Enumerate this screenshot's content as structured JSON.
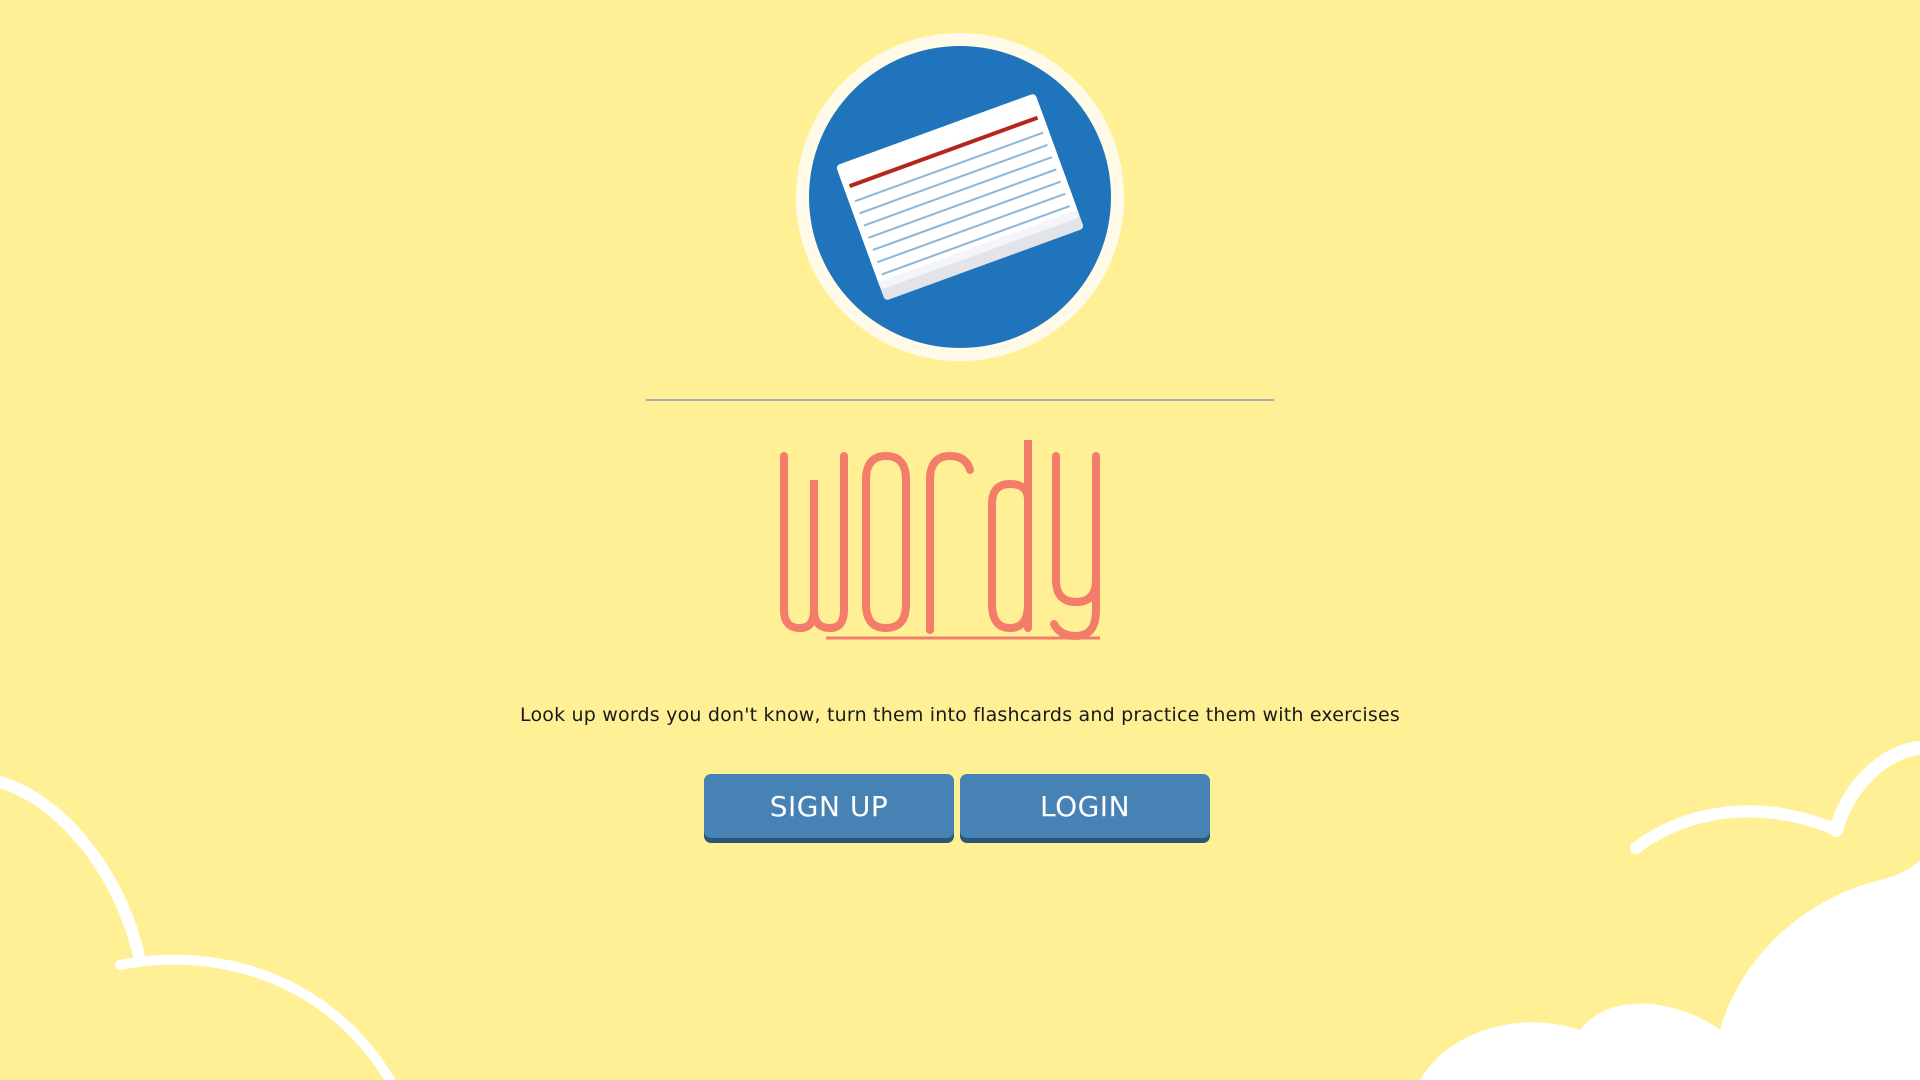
{
  "brand": {
    "name": "wordy",
    "tagline": "Look up words you don't know, turn them into flashcards and practice them with exercises",
    "logo_icon": "flashcard-stack-icon"
  },
  "actions": {
    "signup_label": "SIGN UP",
    "login_label": "LOGIN"
  },
  "colors": {
    "background": "#fff096",
    "logo_circle": "#1f74bc",
    "wordmark": "#f47c6a",
    "button": "#4682b4",
    "button_shadow": "#2c5577",
    "card_red_line": "#b5261b",
    "card_blue_lines": "#8cb6d8"
  }
}
